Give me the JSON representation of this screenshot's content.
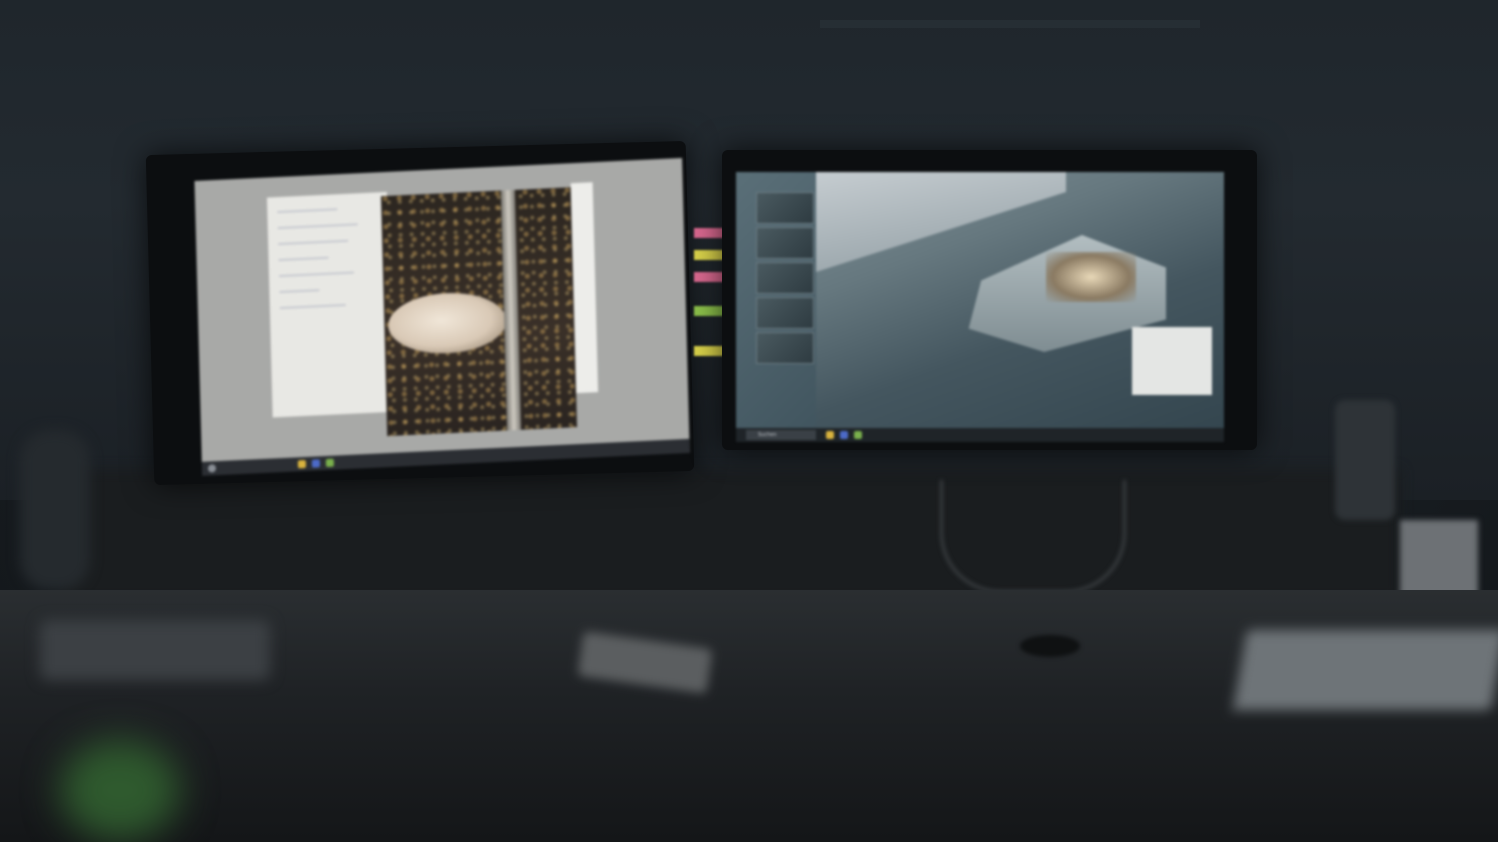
{
  "scene": {
    "description_label": "",
    "right_monitor": {
      "taskbar_search_text": "Suchen"
    }
  },
  "colors": {
    "left_screen_bg": "#a8a9a7",
    "right_screen_tint": "#4a5f68",
    "taskbar": "#2b2e33",
    "sticky_pink": "#d9688f",
    "sticky_yellow": "#d8d14a",
    "sticky_green": "#8bbf4a"
  },
  "icons": [
    "windows-start-icon",
    "search-icon",
    "folder-icon",
    "browser-icon",
    "app-icon"
  ]
}
